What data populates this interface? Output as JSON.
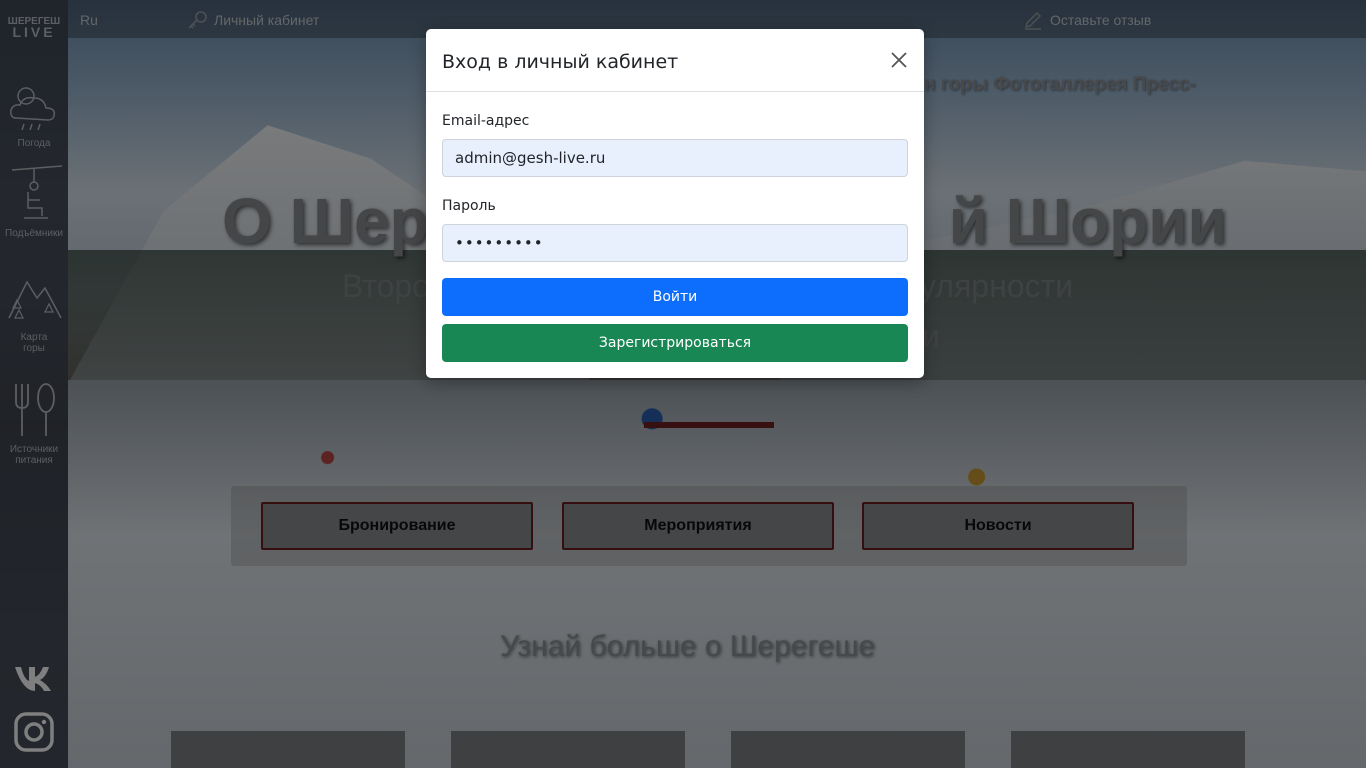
{
  "sidebar": {
    "logo_top": "ШЕРЕГЕШ",
    "logo_bottom": "LIVE",
    "items": [
      {
        "label": "Погода",
        "icon": "weather-icon"
      },
      {
        "label": "Подъёмники",
        "icon": "ski-lift-icon"
      },
      {
        "label": "Карта горы",
        "icon": "mountain-map-icon"
      },
      {
        "label": "Источники питания",
        "icon": "food-icon"
      }
    ],
    "social": [
      {
        "name": "vk",
        "icon": "vk-icon"
      },
      {
        "name": "instagram",
        "icon": "instagram-icon"
      }
    ]
  },
  "topbar": {
    "lang": "Ru",
    "cabinet_label": "Личный кабинет",
    "feedback_label": "Оставьте отзыв"
  },
  "hero": {
    "nav_partial": "н горы  Фотогаллерея  Пресс-",
    "title_left": "О Шер",
    "title_right": "й Шории",
    "subtitle_left": "Второ",
    "subtitle_right": "улярности",
    "subtitle_line2": "и",
    "buttons": [
      "Бронирование",
      "Мероприятия",
      "Новости"
    ],
    "learn_more": "Узнай больше о Шерегеше"
  },
  "modal": {
    "title": "Вход в личный кабинет",
    "email_label": "Email-адрес",
    "email_value": "admin@gesh-live.ru",
    "password_label": "Пароль",
    "password_value": "•••••••••",
    "login_button": "Войти",
    "register_button": "Зарегистрироваться"
  },
  "colors": {
    "primary": "#0d6efd",
    "success": "#198754",
    "accent_dark_red": "#6b1c1e"
  }
}
